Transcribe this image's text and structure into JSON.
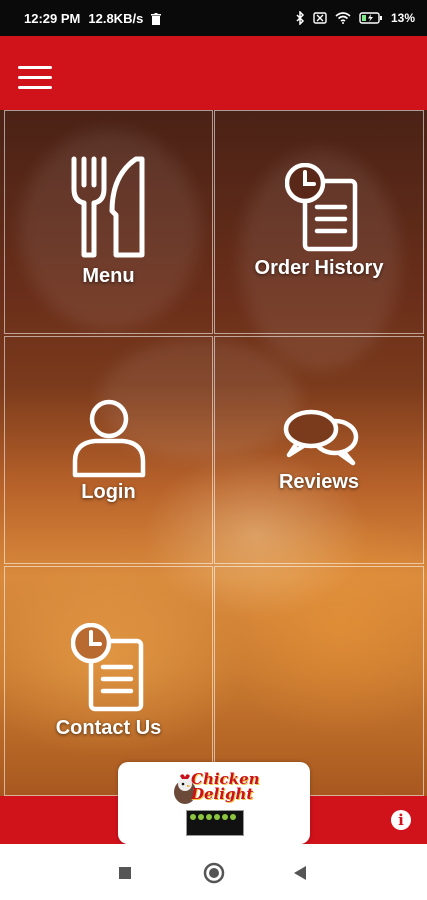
{
  "status_bar": {
    "time": "12:29 PM",
    "network_speed": "12.8KB/s",
    "battery": "13%"
  },
  "app_bar": {
    "menu_icon": "hamburger-icon"
  },
  "tiles": [
    {
      "label": "Menu",
      "icon": "fork-knife-icon"
    },
    {
      "label": "Order History",
      "icon": "clock-document-icon"
    },
    {
      "label": "Login",
      "icon": "user-icon"
    },
    {
      "label": "Reviews",
      "icon": "chat-bubbles-icon"
    },
    {
      "label": "Contact Us",
      "icon": "clock-document-icon"
    }
  ],
  "footer": {
    "info_icon": "info-icon",
    "info_glyph": "i"
  },
  "logo": {
    "text": "Chicken Delight"
  },
  "colors": {
    "brand_red": "#d0121b",
    "status_bar": "#0a0a0a",
    "tile_text": "#ffffff"
  }
}
